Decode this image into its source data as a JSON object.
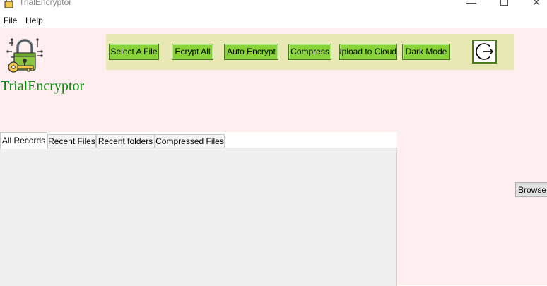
{
  "window": {
    "title": "TrialEncryptor",
    "controls": {
      "minimize": "—",
      "close": "✕"
    }
  },
  "menubar": {
    "items": [
      "File",
      "Help"
    ]
  },
  "app": {
    "name": "TrialEncryptor",
    "logo_icon": "padlock-key-logo-icon"
  },
  "toolbar": {
    "buttons": [
      {
        "label": "Select A File"
      },
      {
        "label": "Ecrypt All"
      },
      {
        "label": "Auto Encrypt"
      },
      {
        "label": "Compress"
      },
      {
        "label": "Upload to Cloud"
      },
      {
        "label": "Dark Mode"
      }
    ],
    "exit_icon": "exit-arrow-icon"
  },
  "tabs": [
    {
      "label": "All Records",
      "active": true
    },
    {
      "label": "Recent Files",
      "active": false
    },
    {
      "label": "Recent folders",
      "active": false
    },
    {
      "label": "Compressed Files",
      "active": false
    }
  ],
  "browse": {
    "label": "Browse"
  },
  "colors": {
    "background": "#ffeef0",
    "toolbar_bg": "#e8e8b4",
    "button_green": "#88d438",
    "app_name_green": "#0a8a0a"
  }
}
